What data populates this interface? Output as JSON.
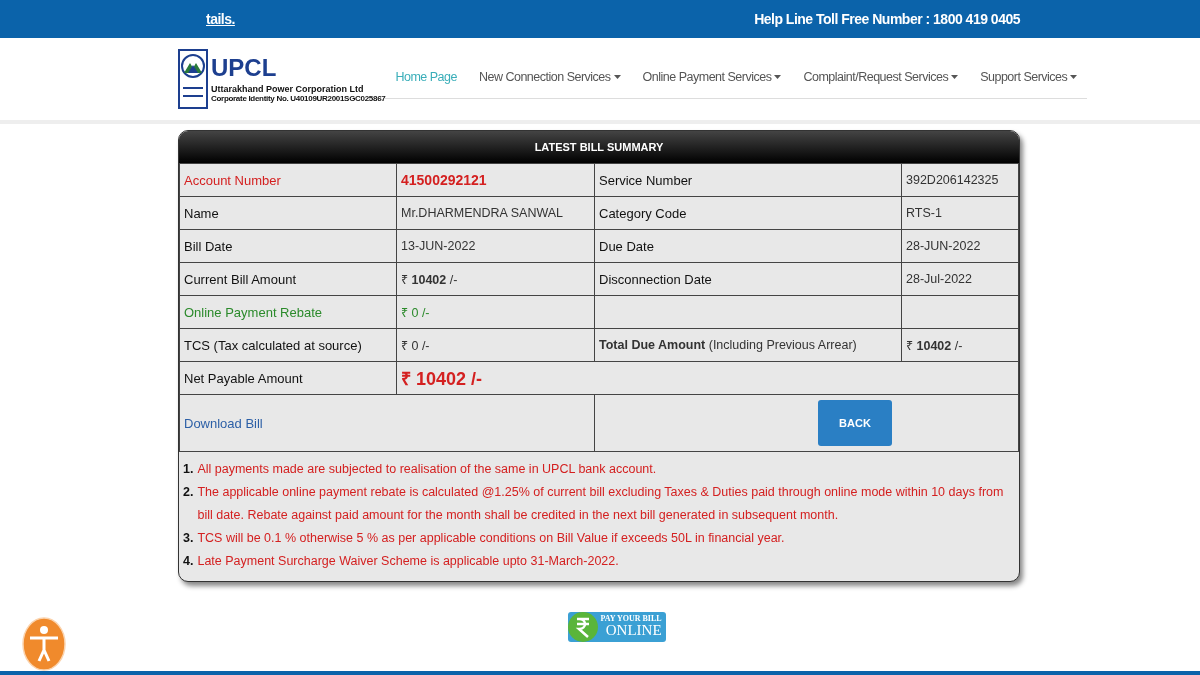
{
  "top_bar": {
    "marquee": "tails.",
    "helpline": "Help Line Toll Free Number : 1800 419 0405"
  },
  "logo": {
    "name": "UPCL",
    "company": "Uttarakhand Power Corporation Ltd",
    "cin": "Corporate Identity No. U40109UR2001SGC025867"
  },
  "nav": [
    {
      "label": "Home Page",
      "selected": true,
      "dropdown": false
    },
    {
      "label": "New Connection Services",
      "selected": false,
      "dropdown": true
    },
    {
      "label": "Online Payment Services",
      "selected": false,
      "dropdown": true
    },
    {
      "label": "Complaint/Request Services",
      "selected": false,
      "dropdown": true
    },
    {
      "label": "Support Services",
      "selected": false,
      "dropdown": true
    }
  ],
  "bill_summary": {
    "title": "LATEST BILL SUMMARY",
    "rows": [
      [
        {
          "text": "Account Number",
          "kind": "highlight"
        },
        {
          "text": "41500292121",
          "kind": "highlightvalue"
        },
        {
          "text": "Service Number",
          "kind": "label"
        },
        {
          "text": "392D206142325",
          "kind": "value"
        }
      ],
      [
        {
          "text": "Name",
          "kind": "label"
        },
        {
          "text": "Mr.DHARMENDRA SANWAL",
          "kind": "value"
        },
        {
          "text": "Category Code",
          "kind": "label"
        },
        {
          "text": "RTS-1",
          "kind": "value"
        }
      ],
      [
        {
          "text": "Bill Date",
          "kind": "label"
        },
        {
          "text": "13-JUN-2022",
          "kind": "value"
        },
        {
          "text": "Due Date",
          "kind": "label"
        },
        {
          "text": "28-JUN-2022",
          "kind": "value"
        }
      ],
      [
        {
          "text": "Current Bill Amount",
          "kind": "label"
        },
        {
          "text": "₹ **10402** /-",
          "kind": "value"
        },
        {
          "text": "Disconnection Date",
          "kind": "label"
        },
        {
          "text": "28-Jul-2022",
          "kind": "value"
        }
      ],
      [
        {
          "text": "Online Payment Rebate",
          "kind": "rebate"
        },
        {
          "text": "₹ 0 /-",
          "kind": "rebatevalue"
        },
        {
          "kind": "empty"
        },
        {
          "kind": "empty"
        }
      ],
      [
        {
          "text": "TCS (Tax calculated at source)",
          "kind": "label"
        },
        {
          "text": "₹ 0 /-",
          "kind": "value"
        },
        {
          "text": "**Total Due Amount** (Including Previous Arrear)",
          "kind": "value"
        },
        {
          "text": "₹ **10402** /-",
          "kind": "value"
        }
      ]
    ],
    "net_payable": {
      "label": "Net Payable Amount",
      "amount": "₹ 10402 /-"
    },
    "download_link": "Download Bill",
    "back_button": "BACK",
    "notes": [
      {
        "number": "1.",
        "text": "All payments made are subjected to realisation of the same in UPCL bank account."
      },
      {
        "number": "2.",
        "text": "The applicable online payment rebate is calculated @1.25% of current bill excluding Taxes & Duties paid through online mode within 10 days from bill date. Rebate against paid amount for the month shall be credited in the next bill generated in subsequent month."
      },
      {
        "number": "3.",
        "text": "TCS will be 0.1 % otherwise 5 % as per applicable conditions on Bill Value if exceeds 50L in financial year."
      },
      {
        "number": "4.",
        "text": "Late Payment Surcharge Waiver Scheme is applicable upto 31-March-2022."
      }
    ]
  },
  "pay_online": {
    "line_1": "PAY YOUR BILL",
    "line_2": "ONLINE"
  }
}
